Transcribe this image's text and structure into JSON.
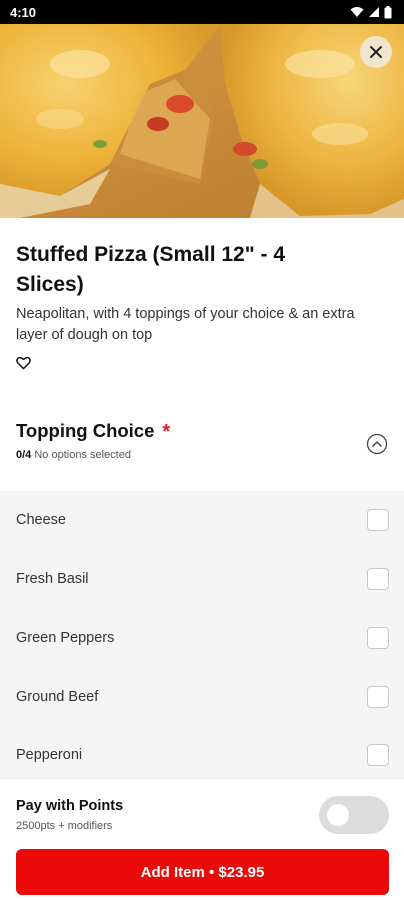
{
  "status_bar": {
    "time": "4:10"
  },
  "item": {
    "title": "Stuffed Pizza (Small 12\" - 4 Slices)",
    "description": "Neapolitan, with 4 toppings of your choice & an extra layer of dough on top"
  },
  "topping_section": {
    "title": "Topping Choice",
    "required_marker": "*",
    "selected_count": "0/4",
    "status_text": "No options selected",
    "options": [
      {
        "label": "Cheese",
        "checked": false
      },
      {
        "label": "Fresh Basil",
        "checked": false
      },
      {
        "label": "Green Peppers",
        "checked": false
      },
      {
        "label": "Ground Beef",
        "checked": false
      },
      {
        "label": "Pepperoni",
        "checked": false
      }
    ]
  },
  "pay_points": {
    "title": "Pay with Points",
    "subtitle": "2500pts + modifiers",
    "enabled": false
  },
  "add_button": {
    "label": "Add Item • $23.95"
  },
  "colors": {
    "accent": "#ea0a0a",
    "required": "#e51b23",
    "options_bg": "#f5f5f5"
  },
  "icons": [
    "wifi-icon",
    "signal-icon",
    "battery-icon",
    "close-icon",
    "heart-outline-icon",
    "chevron-up-circle-icon"
  ]
}
